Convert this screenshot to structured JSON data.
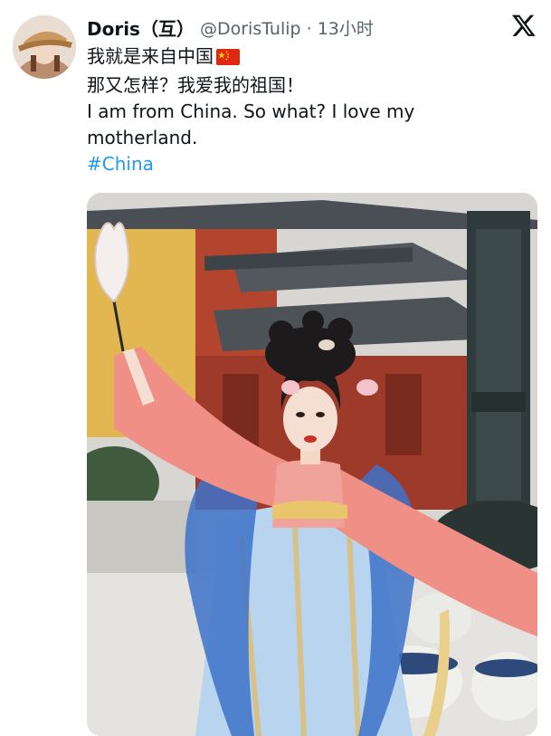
{
  "tweet": {
    "display_name": "Doris（互）",
    "handle_time": "@DorisTulip · 13小时",
    "lines": [
      "我就是来自中国",
      "那又怎样？我爱我的祖国！",
      "I am from China. So what? I love my",
      "motherland."
    ],
    "flag_icon": "china-flag-icon",
    "hashtag": "#China"
  },
  "icons": {
    "brand": "x-logo-icon",
    "avatar": "avatar"
  },
  "colors": {
    "name": "#0f1419",
    "secondary": "#536471",
    "link": "#1d9bf0",
    "flag_red": "#de2910",
    "flag_star": "#ffde00"
  }
}
